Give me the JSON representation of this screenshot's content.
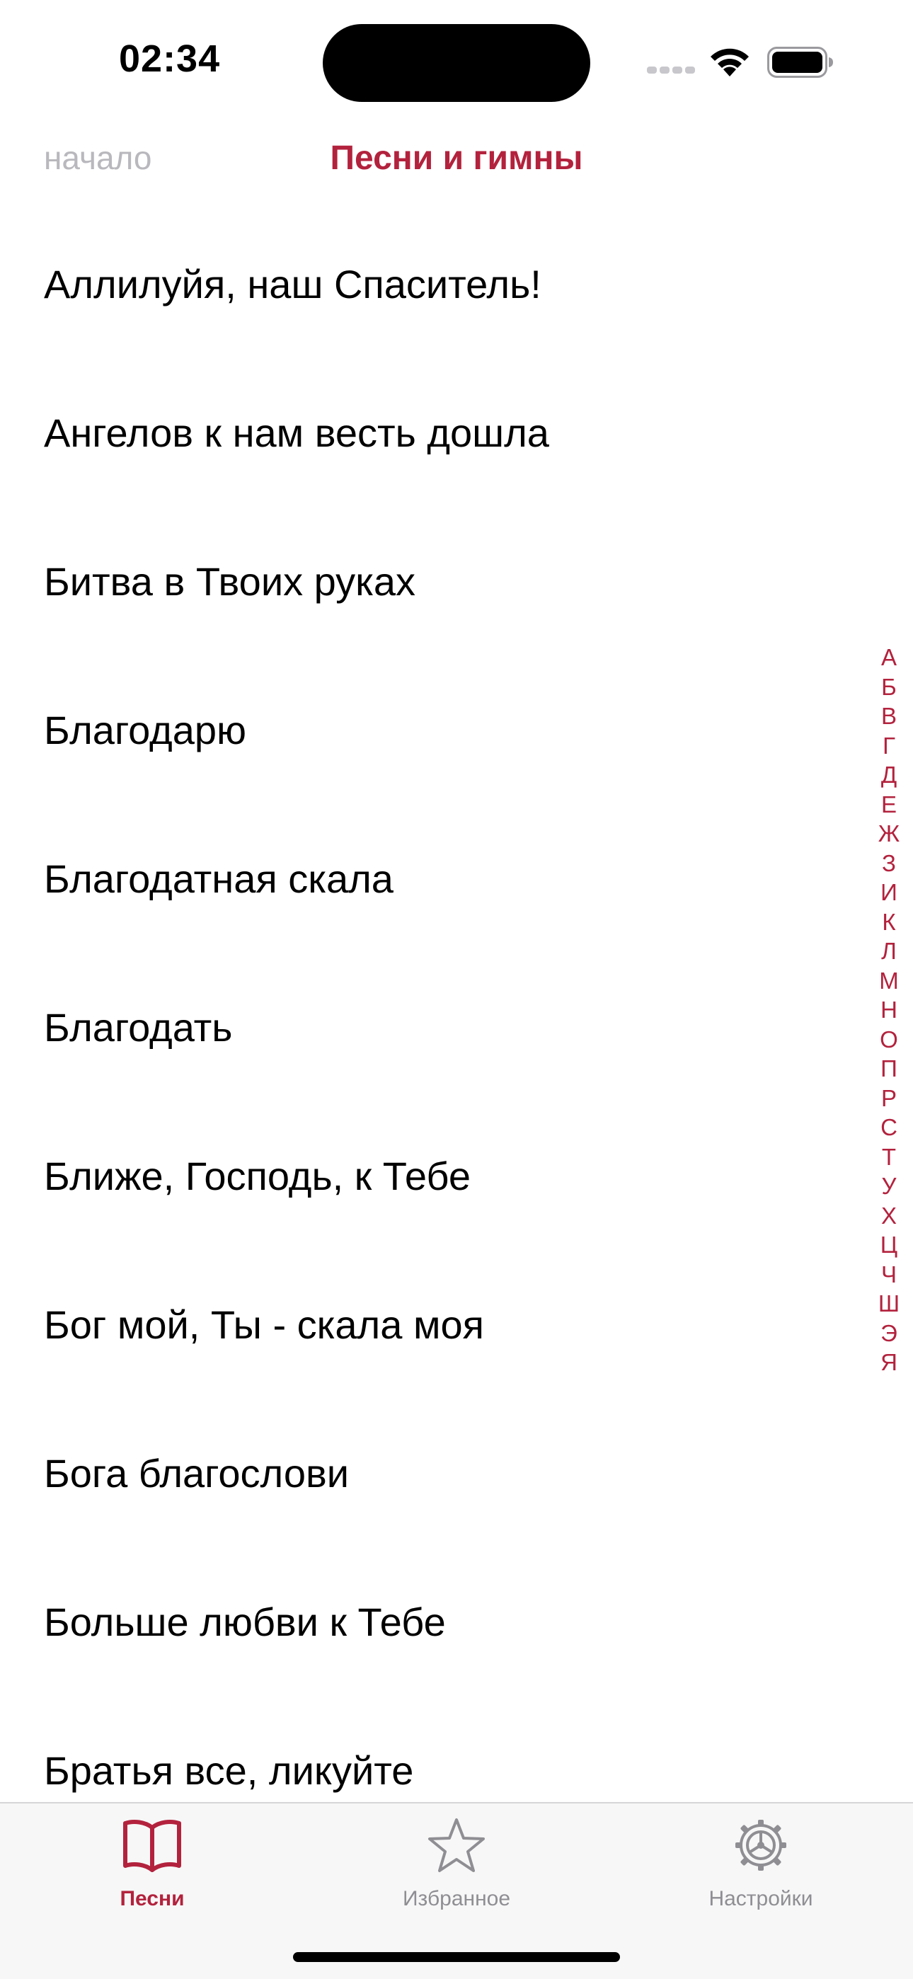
{
  "status_bar": {
    "time": "02:34",
    "icons": [
      "signal-icon",
      "wifi-icon",
      "battery-icon"
    ]
  },
  "nav": {
    "back_label": "начало",
    "title": "Песни и гимны"
  },
  "songs": [
    "Аллилуйя, наш Спаситель!",
    "Ангелов к нам весть дошла",
    "Битва в Твоих руках",
    "Благодарю",
    "Благодатная скала",
    "Благодать",
    "Ближе, Господь, к Тебе",
    "Бог мой, Ты - скала моя",
    "Бога благослови",
    "Больше любви к Тебе",
    "Братья все, ликуйте"
  ],
  "alphabet": [
    "А",
    "Б",
    "В",
    "Г",
    "Д",
    "Е",
    "Ж",
    "З",
    "И",
    "К",
    "Л",
    "М",
    "Н",
    "О",
    "П",
    "Р",
    "С",
    "Т",
    "У",
    "Х",
    "Ц",
    "Ч",
    "Ш",
    "Э",
    "Я"
  ],
  "tabs": [
    {
      "label": "Песни",
      "icon": "book-icon",
      "active": true
    },
    {
      "label": "Избранное",
      "icon": "star-icon",
      "active": false
    },
    {
      "label": "Настройки",
      "icon": "gear-icon",
      "active": false
    }
  ],
  "colors": {
    "accent": "#b3223d",
    "inactive": "#8e8e93",
    "back_link": "#b8b8bd"
  }
}
